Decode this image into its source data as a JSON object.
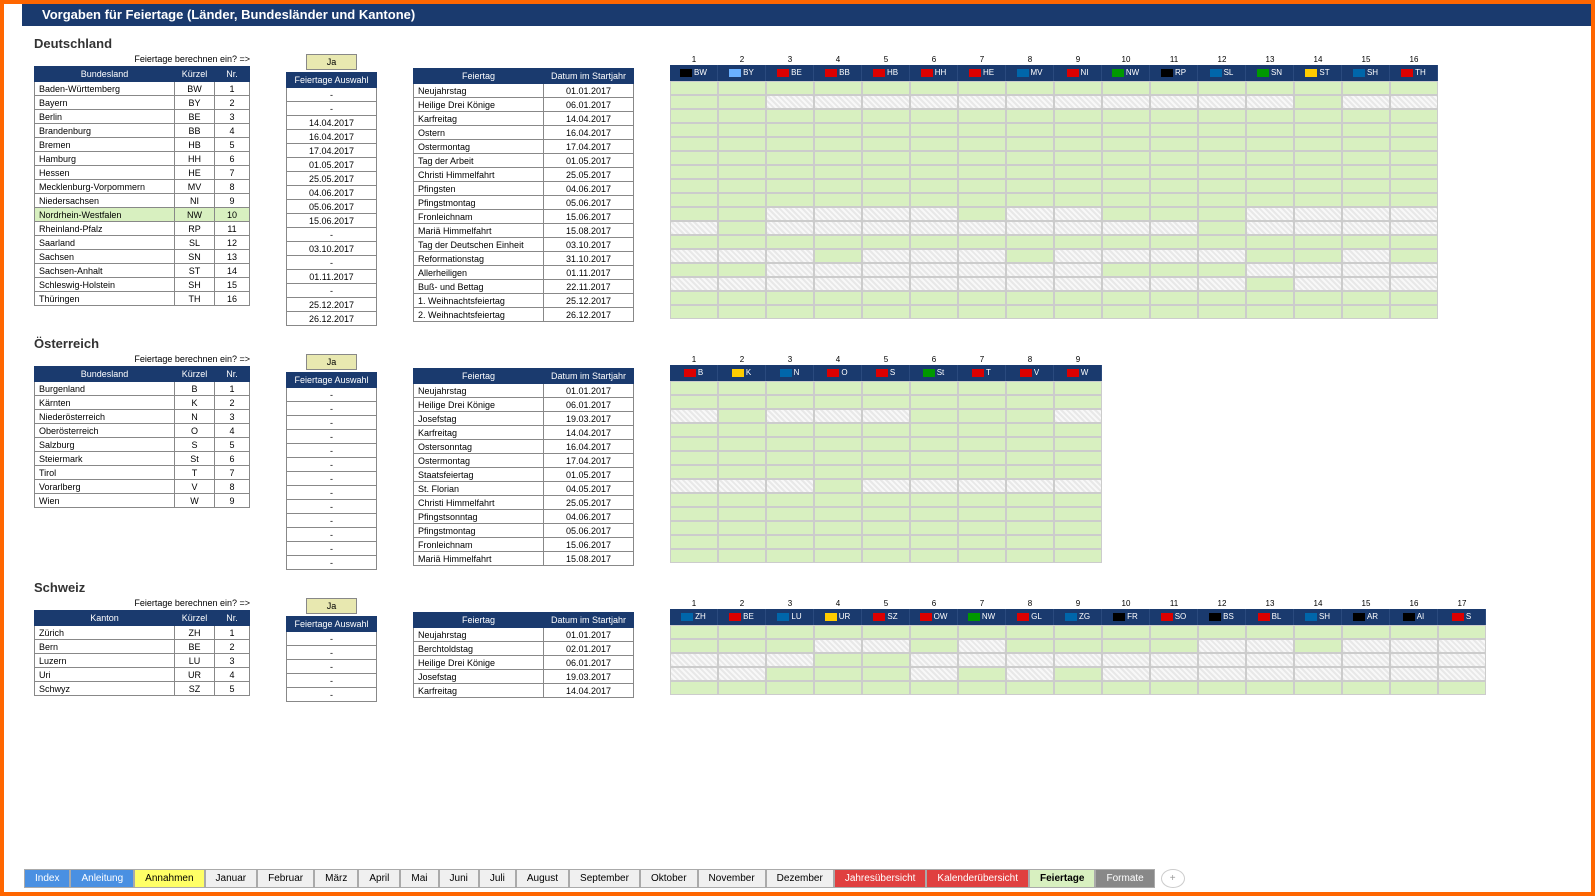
{
  "title": "Vorgaben für Feiertage  (Länder, Bundesländer und Kantone)",
  "prompt": "Feiertage berechnen ein? =>",
  "ja": "Ja",
  "headers": {
    "bundesland": "Bundesland",
    "kanton": "Kanton",
    "kuerzel": "Kürzel",
    "nr": "Nr.",
    "auswahl": "Feiertage Auswahl",
    "feiertag": "Feiertag",
    "datum": "Datum im Startjahr"
  },
  "germany": {
    "title": "Deutschland",
    "states": [
      {
        "name": "Baden-Württemberg",
        "k": "BW",
        "n": "1"
      },
      {
        "name": "Bayern",
        "k": "BY",
        "n": "2"
      },
      {
        "name": "Berlin",
        "k": "BE",
        "n": "3"
      },
      {
        "name": "Brandenburg",
        "k": "BB",
        "n": "4"
      },
      {
        "name": "Bremen",
        "k": "HB",
        "n": "5"
      },
      {
        "name": "Hamburg",
        "k": "HH",
        "n": "6"
      },
      {
        "name": "Hessen",
        "k": "HE",
        "n": "7"
      },
      {
        "name": "Mecklenburg-Vorpommern",
        "k": "MV",
        "n": "8"
      },
      {
        "name": "Niedersachsen",
        "k": "NI",
        "n": "9"
      },
      {
        "name": "Nordrhein-Westfalen",
        "k": "NW",
        "n": "10",
        "hl": true
      },
      {
        "name": "Rheinland-Pfalz",
        "k": "RP",
        "n": "11"
      },
      {
        "name": "Saarland",
        "k": "SL",
        "n": "12"
      },
      {
        "name": "Sachsen",
        "k": "SN",
        "n": "13"
      },
      {
        "name": "Sachsen-Anhalt",
        "k": "ST",
        "n": "14"
      },
      {
        "name": "Schleswig-Holstein",
        "k": "SH",
        "n": "15"
      },
      {
        "name": "Thüringen",
        "k": "TH",
        "n": "16"
      }
    ],
    "auswahl": [
      "-",
      "-",
      "14.04.2017",
      "16.04.2017",
      "17.04.2017",
      "01.05.2017",
      "25.05.2017",
      "04.06.2017",
      "05.06.2017",
      "15.06.2017",
      "-",
      "03.10.2017",
      "-",
      "01.11.2017",
      "-",
      "25.12.2017",
      "26.12.2017"
    ],
    "holidays": [
      {
        "name": "Neujahrstag",
        "d": "01.01.2017"
      },
      {
        "name": "Heilige Drei Könige",
        "d": "06.01.2017"
      },
      {
        "name": "Karfreitag",
        "d": "14.04.2017"
      },
      {
        "name": "Ostern",
        "d": "16.04.2017"
      },
      {
        "name": "Ostermontag",
        "d": "17.04.2017"
      },
      {
        "name": "Tag der Arbeit",
        "d": "01.05.2017"
      },
      {
        "name": "Christi Himmelfahrt",
        "d": "25.05.2017"
      },
      {
        "name": "Pfingsten",
        "d": "04.06.2017"
      },
      {
        "name": "Pfingstmontag",
        "d": "05.06.2017"
      },
      {
        "name": "Fronleichnam",
        "d": "15.06.2017"
      },
      {
        "name": "Mariä Himmelfahrt",
        "d": "15.08.2017"
      },
      {
        "name": "Tag der Deutschen Einheit",
        "d": "03.10.2017"
      },
      {
        "name": "Reformationstag",
        "d": "31.10.2017"
      },
      {
        "name": "Allerheiligen",
        "d": "01.11.2017"
      },
      {
        "name": "Buß- und Bettag",
        "d": "22.11.2017"
      },
      {
        "name": "1. Weihnachtsfeiertag",
        "d": "25.12.2017"
      },
      {
        "name": "2. Weihnachtsfeiertag",
        "d": "26.12.2017"
      }
    ],
    "matrix_cols": [
      "BW",
      "BY",
      "BE",
      "BB",
      "HB",
      "HH",
      "HE",
      "MV",
      "NI",
      "NW",
      "RP",
      "SL",
      "SN",
      "ST",
      "SH",
      "TH"
    ],
    "matrix": [
      [
        1,
        1,
        1,
        1,
        1,
        1,
        1,
        1,
        1,
        1,
        1,
        1,
        1,
        1,
        1,
        1
      ],
      [
        1,
        1,
        0,
        0,
        0,
        0,
        0,
        0,
        0,
        0,
        0,
        0,
        0,
        1,
        0,
        0
      ],
      [
        1,
        1,
        1,
        1,
        1,
        1,
        1,
        1,
        1,
        1,
        1,
        1,
        1,
        1,
        1,
        1
      ],
      [
        1,
        1,
        1,
        1,
        1,
        1,
        1,
        1,
        1,
        1,
        1,
        1,
        1,
        1,
        1,
        1
      ],
      [
        1,
        1,
        1,
        1,
        1,
        1,
        1,
        1,
        1,
        1,
        1,
        1,
        1,
        1,
        1,
        1
      ],
      [
        1,
        1,
        1,
        1,
        1,
        1,
        1,
        1,
        1,
        1,
        1,
        1,
        1,
        1,
        1,
        1
      ],
      [
        1,
        1,
        1,
        1,
        1,
        1,
        1,
        1,
        1,
        1,
        1,
        1,
        1,
        1,
        1,
        1
      ],
      [
        1,
        1,
        1,
        1,
        1,
        1,
        1,
        1,
        1,
        1,
        1,
        1,
        1,
        1,
        1,
        1
      ],
      [
        1,
        1,
        1,
        1,
        1,
        1,
        1,
        1,
        1,
        1,
        1,
        1,
        1,
        1,
        1,
        1
      ],
      [
        1,
        1,
        0,
        0,
        0,
        0,
        1,
        0,
        0,
        1,
        1,
        1,
        0,
        0,
        0,
        0
      ],
      [
        0,
        1,
        0,
        0,
        0,
        0,
        0,
        0,
        0,
        0,
        0,
        1,
        0,
        0,
        0,
        0
      ],
      [
        1,
        1,
        1,
        1,
        1,
        1,
        1,
        1,
        1,
        1,
        1,
        1,
        1,
        1,
        1,
        1
      ],
      [
        0,
        0,
        0,
        1,
        0,
        0,
        0,
        1,
        0,
        0,
        0,
        0,
        1,
        1,
        0,
        1
      ],
      [
        1,
        1,
        0,
        0,
        0,
        0,
        0,
        0,
        0,
        1,
        1,
        1,
        0,
        0,
        0,
        0
      ],
      [
        0,
        0,
        0,
        0,
        0,
        0,
        0,
        0,
        0,
        0,
        0,
        0,
        1,
        0,
        0,
        0
      ],
      [
        1,
        1,
        1,
        1,
        1,
        1,
        1,
        1,
        1,
        1,
        1,
        1,
        1,
        1,
        1,
        1
      ],
      [
        1,
        1,
        1,
        1,
        1,
        1,
        1,
        1,
        1,
        1,
        1,
        1,
        1,
        1,
        1,
        1
      ]
    ]
  },
  "austria": {
    "title": "Österreich",
    "states": [
      {
        "name": "Burgenland",
        "k": "B",
        "n": "1"
      },
      {
        "name": "Kärnten",
        "k": "K",
        "n": "2"
      },
      {
        "name": "Niederösterreich",
        "k": "N",
        "n": "3"
      },
      {
        "name": "Oberösterreich",
        "k": "O",
        "n": "4"
      },
      {
        "name": "Salzburg",
        "k": "S",
        "n": "5"
      },
      {
        "name": "Steiermark",
        "k": "St",
        "n": "6"
      },
      {
        "name": "Tirol",
        "k": "T",
        "n": "7"
      },
      {
        "name": "Vorarlberg",
        "k": "V",
        "n": "8"
      },
      {
        "name": "Wien",
        "k": "W",
        "n": "9"
      }
    ],
    "auswahl": [
      "-",
      "-",
      "-",
      "-",
      "-",
      "-",
      "-",
      "-",
      "-",
      "-",
      "-",
      "-",
      "-"
    ],
    "holidays": [
      {
        "name": "Neujahrstag",
        "d": "01.01.2017"
      },
      {
        "name": "Heilige Drei Könige",
        "d": "06.01.2017"
      },
      {
        "name": "Josefstag",
        "d": "19.03.2017"
      },
      {
        "name": "Karfreitag",
        "d": "14.04.2017"
      },
      {
        "name": "Ostersonntag",
        "d": "16.04.2017"
      },
      {
        "name": "Ostermontag",
        "d": "17.04.2017"
      },
      {
        "name": "Staatsfeiertag",
        "d": "01.05.2017"
      },
      {
        "name": "St. Florian",
        "d": "04.05.2017"
      },
      {
        "name": "Christi Himmelfahrt",
        "d": "25.05.2017"
      },
      {
        "name": "Pfingstsonntag",
        "d": "04.06.2017"
      },
      {
        "name": "Pfingstmontag",
        "d": "05.06.2017"
      },
      {
        "name": "Fronleichnam",
        "d": "15.06.2017"
      },
      {
        "name": "Mariä Himmelfahrt",
        "d": "15.08.2017"
      }
    ],
    "matrix_cols": [
      "B",
      "K",
      "N",
      "O",
      "S",
      "St",
      "T",
      "V",
      "W"
    ],
    "matrix": [
      [
        1,
        1,
        1,
        1,
        1,
        1,
        1,
        1,
        1
      ],
      [
        1,
        1,
        1,
        1,
        1,
        1,
        1,
        1,
        1
      ],
      [
        0,
        1,
        0,
        0,
        0,
        1,
        1,
        1,
        0
      ],
      [
        1,
        1,
        1,
        1,
        1,
        1,
        1,
        1,
        1
      ],
      [
        1,
        1,
        1,
        1,
        1,
        1,
        1,
        1,
        1
      ],
      [
        1,
        1,
        1,
        1,
        1,
        1,
        1,
        1,
        1
      ],
      [
        1,
        1,
        1,
        1,
        1,
        1,
        1,
        1,
        1
      ],
      [
        0,
        0,
        0,
        1,
        0,
        0,
        0,
        0,
        0
      ],
      [
        1,
        1,
        1,
        1,
        1,
        1,
        1,
        1,
        1
      ],
      [
        1,
        1,
        1,
        1,
        1,
        1,
        1,
        1,
        1
      ],
      [
        1,
        1,
        1,
        1,
        1,
        1,
        1,
        1,
        1
      ],
      [
        1,
        1,
        1,
        1,
        1,
        1,
        1,
        1,
        1
      ],
      [
        1,
        1,
        1,
        1,
        1,
        1,
        1,
        1,
        1
      ]
    ]
  },
  "swiss": {
    "title": "Schweiz",
    "states": [
      {
        "name": "Zürich",
        "k": "ZH",
        "n": "1"
      },
      {
        "name": "Bern",
        "k": "BE",
        "n": "2"
      },
      {
        "name": "Luzern",
        "k": "LU",
        "n": "3"
      },
      {
        "name": "Uri",
        "k": "UR",
        "n": "4"
      },
      {
        "name": "Schwyz",
        "k": "SZ",
        "n": "5"
      }
    ],
    "auswahl": [
      "-",
      "-",
      "-",
      "-",
      "-"
    ],
    "holidays": [
      {
        "name": "Neujahrstag",
        "d": "01.01.2017"
      },
      {
        "name": "Berchtoldstag",
        "d": "02.01.2017"
      },
      {
        "name": "Heilige Drei Könige",
        "d": "06.01.2017"
      },
      {
        "name": "Josefstag",
        "d": "19.03.2017"
      },
      {
        "name": "Karfreitag",
        "d": "14.04.2017"
      }
    ],
    "matrix_cols": [
      "ZH",
      "BE",
      "LU",
      "UR",
      "SZ",
      "OW",
      "NW",
      "GL",
      "ZG",
      "FR",
      "SO",
      "BS",
      "BL",
      "SH",
      "AR",
      "AI",
      "S"
    ],
    "matrix": [
      [
        1,
        1,
        1,
        1,
        1,
        1,
        1,
        1,
        1,
        1,
        1,
        1,
        1,
        1,
        1,
        1,
        1
      ],
      [
        1,
        1,
        1,
        0,
        0,
        1,
        0,
        1,
        1,
        1,
        1,
        0,
        0,
        1,
        0,
        0,
        0
      ],
      [
        0,
        0,
        0,
        1,
        1,
        0,
        0,
        0,
        0,
        0,
        0,
        0,
        0,
        0,
        0,
        0,
        0
      ],
      [
        0,
        0,
        1,
        1,
        1,
        0,
        1,
        0,
        1,
        0,
        0,
        0,
        0,
        0,
        0,
        0,
        0
      ],
      [
        1,
        1,
        1,
        1,
        1,
        1,
        1,
        1,
        1,
        1,
        1,
        1,
        1,
        1,
        1,
        1,
        1
      ]
    ]
  },
  "tabs": [
    {
      "label": "Index",
      "cls": "blue"
    },
    {
      "label": "Anleitung",
      "cls": "blue"
    },
    {
      "label": "Annahmen",
      "cls": "yellow"
    },
    {
      "label": "Januar",
      "cls": ""
    },
    {
      "label": "Februar",
      "cls": ""
    },
    {
      "label": "März",
      "cls": ""
    },
    {
      "label": "April",
      "cls": ""
    },
    {
      "label": "Mai",
      "cls": ""
    },
    {
      "label": "Juni",
      "cls": ""
    },
    {
      "label": "Juli",
      "cls": ""
    },
    {
      "label": "August",
      "cls": ""
    },
    {
      "label": "September",
      "cls": ""
    },
    {
      "label": "Oktober",
      "cls": ""
    },
    {
      "label": "November",
      "cls": ""
    },
    {
      "label": "Dezember",
      "cls": ""
    },
    {
      "label": "Jahresübersicht",
      "cls": "red"
    },
    {
      "label": "Kalenderübersicht",
      "cls": "red"
    },
    {
      "label": "Feiertage",
      "cls": "green"
    },
    {
      "label": "Formate",
      "cls": "grey"
    }
  ],
  "flag_colors": {
    "BW": "#000",
    "BY": "#6ab0ff",
    "BE": "#d00",
    "BB": "#d00",
    "HB": "#d00",
    "HH": "#d00",
    "HE": "#d00",
    "MV": "#06a",
    "NI": "#d00",
    "NW": "#090",
    "RP": "#000",
    "SL": "#06a",
    "SN": "#090",
    "ST": "#fc0",
    "SH": "#06a",
    "TH": "#d00",
    "B": "#d00",
    "K": "#fc0",
    "N": "#06a",
    "O": "#d00",
    "S": "#d00",
    "St": "#090",
    "T": "#d00",
    "V": "#d00",
    "W": "#d00",
    "ZH": "#06a",
    "LU": "#06a",
    "UR": "#fc0",
    "SZ": "#d00",
    "OW": "#d00",
    "NW2": "#d00",
    "GL": "#d00",
    "ZG": "#06a",
    "FR": "#000",
    "SO": "#d00",
    "BS": "#000",
    "BL": "#d00",
    "SH2": "#fc0",
    "AR": "#000",
    "AI": "#000"
  }
}
